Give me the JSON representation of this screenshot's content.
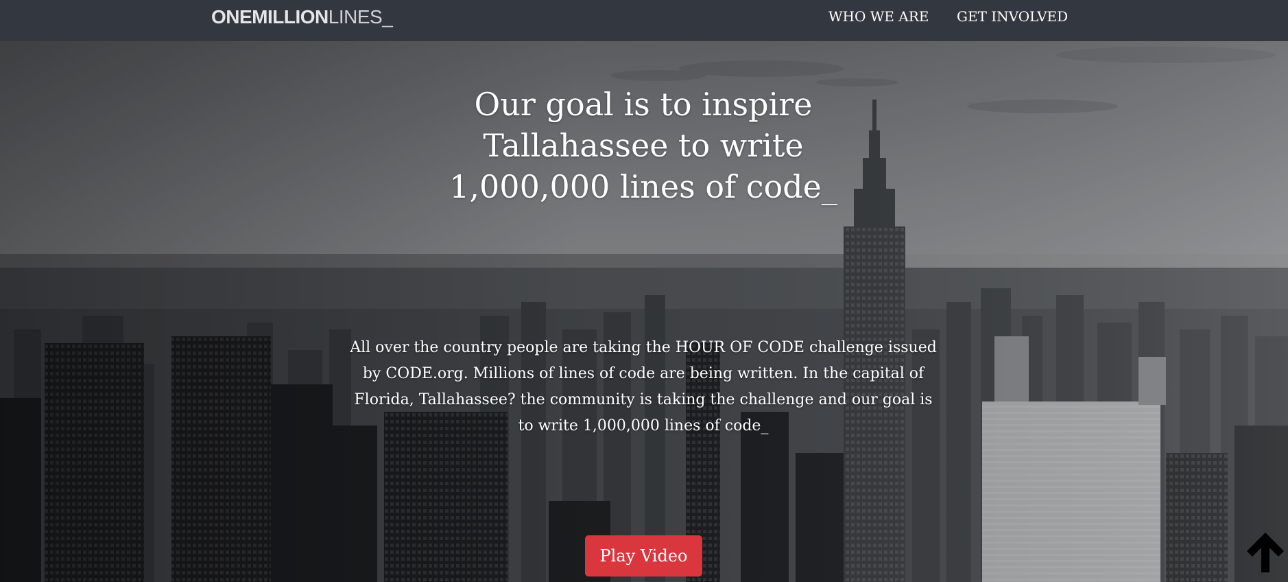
{
  "navbar": {
    "logo_bold": "ONEMILLION",
    "logo_thin": "LINES_",
    "links": [
      {
        "label": "WHO WE ARE"
      },
      {
        "label": "GET INVOLVED"
      }
    ]
  },
  "hero": {
    "headline": "Our goal is to inspire Tallahassee to write 1,000,000 lines of code_",
    "paragraph": "All over the country people are taking the HOUR OF CODE challenge issued by CODE.org. Millions of lines of code are being written. In the capital of Florida, Tallahassee? the community is taking the challenge and our goal is to write 1,000,000 lines of code_",
    "play_button": "Play Video",
    "button_color": "#d9363e"
  },
  "icons": {
    "scroll_top": "arrow-up-icon"
  }
}
